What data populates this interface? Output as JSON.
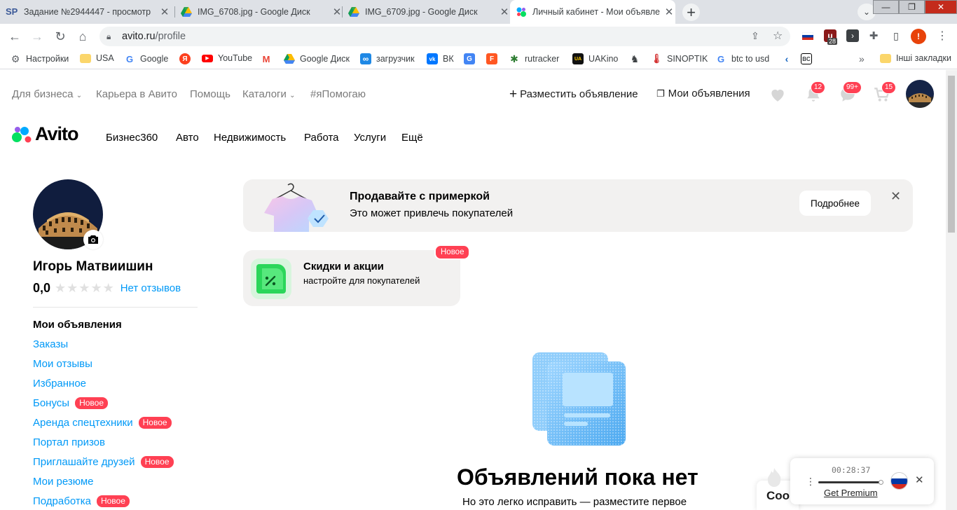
{
  "browser": {
    "tabs": [
      {
        "title": "Задание №2944447 - просмотр",
        "icon": "sp-favicon"
      },
      {
        "title": "IMG_6708.jpg - Google Диск",
        "icon": "google-drive-favicon"
      },
      {
        "title": "IMG_6709.jpg - Google Диск",
        "icon": "google-drive-favicon"
      },
      {
        "title": "Личный кабинет - Мои объявле",
        "icon": "avito-favicon",
        "active": true
      }
    ],
    "url_host": "avito.ru",
    "url_path": "/profile",
    "ext_badge": "28",
    "profile_initial": "!",
    "bookmarks": [
      {
        "label": "Настройки",
        "icon": "gear-icon"
      },
      {
        "label": "USA",
        "icon": "folder-icon"
      },
      {
        "label": "Google",
        "icon": "google-icon"
      },
      {
        "label": "",
        "icon": "yandex-icon"
      },
      {
        "label": "YouTube",
        "icon": "youtube-icon"
      },
      {
        "label": "",
        "icon": "gmail-icon"
      },
      {
        "label": "Google Диск",
        "icon": "google-drive-icon"
      },
      {
        "label": "загрузчик",
        "icon": "infinity-icon"
      },
      {
        "label": "ВК",
        "icon": "vk-icon"
      },
      {
        "label": "",
        "icon": "translate-icon"
      },
      {
        "label": "",
        "icon": "f-icon"
      },
      {
        "label": "rutracker",
        "icon": "rutracker-icon"
      },
      {
        "label": "UAKino",
        "icon": "uakino-icon"
      },
      {
        "label": "",
        "icon": "chess-icon"
      },
      {
        "label": "SINOPTIK",
        "icon": "thermometer-icon"
      },
      {
        "label": "btc to usd",
        "icon": "google-icon"
      },
      {
        "label": "",
        "icon": "arrow-icon"
      },
      {
        "label": "",
        "icon": "bc-icon"
      }
    ],
    "other_bookmarks": "Інші закладки"
  },
  "header": {
    "top_links": [
      "Для бизнеса",
      "Карьера в Авито",
      "Помощь",
      "Каталоги",
      "#яПомогаю"
    ],
    "post_ad": "Разместить объявление",
    "my_ads": "Мои объявления",
    "badges": {
      "notifications": "12",
      "messages": "99+",
      "cart": "15"
    },
    "logo_text": "Avito",
    "categories": [
      "Бизнес360",
      "Авто",
      "Недвижимость",
      "Работа",
      "Услуги",
      "Ещё"
    ]
  },
  "profile": {
    "name": "Игорь Матвиишин",
    "rating": "0,0",
    "reviews": "Нет отзывов",
    "menu_title": "Мои объявления",
    "menu": [
      {
        "label": "Заказы",
        "badge": ""
      },
      {
        "label": "Мои отзывы",
        "badge": ""
      },
      {
        "label": "Избранное",
        "badge": ""
      },
      {
        "label": "Бонусы",
        "badge": "Новое"
      },
      {
        "label": "Аренда спецтехники",
        "badge": "Новое"
      },
      {
        "label": "Портал призов",
        "badge": ""
      },
      {
        "label": "Приглашайте друзей",
        "badge": "Новое"
      },
      {
        "label": "Мои резюме",
        "badge": ""
      },
      {
        "label": "Подработка",
        "badge": "Новое"
      }
    ]
  },
  "promo": {
    "title": "Продавайте с примеркой",
    "subtitle": "Это может привлечь покупателей",
    "button": "Подробнее"
  },
  "discount": {
    "title": "Скидки и акции",
    "subtitle": "настройте для покупателей",
    "badge": "Новое"
  },
  "empty": {
    "title": "Объявлений пока нет",
    "subtitle": "Но это легко исправить — разместите первое"
  },
  "widget": {
    "time": "00:28:37",
    "premium": "Get Premium",
    "cookie_partial": "Coo"
  },
  "colors": {
    "accent_blue": "#0099f7",
    "badge_red": "#ff4053"
  }
}
